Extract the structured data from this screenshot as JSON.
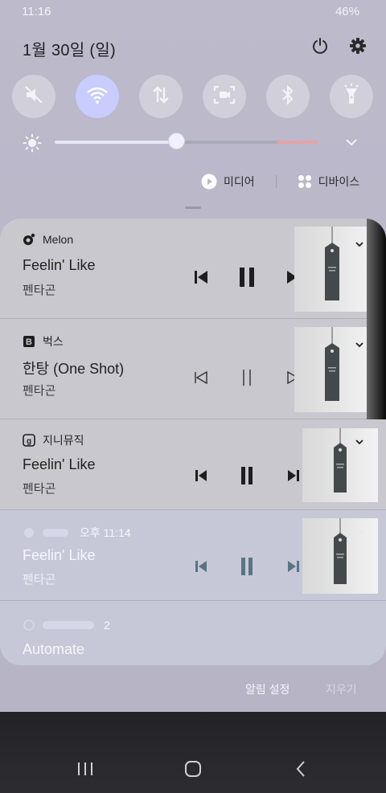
{
  "status_bar": {
    "time": "11:16",
    "battery": "46%"
  },
  "header": {
    "date": "1월 30일 (일)"
  },
  "quick_settings": {
    "tiles": [
      {
        "icon": "sound-off-icon",
        "active": false
      },
      {
        "icon": "wifi-icon",
        "active": true
      },
      {
        "icon": "mobile-data-icon",
        "active": false
      },
      {
        "icon": "screen-recorder-icon",
        "active": false
      },
      {
        "icon": "bluetooth-icon",
        "active": false
      },
      {
        "icon": "flashlight-icon",
        "active": false
      }
    ],
    "brightness_level": 0.46
  },
  "media_row": {
    "media_label": "미디어",
    "devices_label": "디바이스"
  },
  "notifications": [
    {
      "app": "Melon",
      "title": "Feelin' Like",
      "artist": "펜타곤",
      "icon": "melon-app-icon"
    },
    {
      "app": "벅스",
      "title": "한탕 (One Shot)",
      "artist": "펜타곤",
      "icon": "bugs-app-icon"
    },
    {
      "app": "지니뮤직",
      "title": "Feelin' Like",
      "artist": "펜타곤",
      "icon": "genie-app-icon"
    },
    {
      "app": "",
      "time": "오후 11:14",
      "title": "Feelin' Like",
      "artist": "펜타곤",
      "icon": "music-app-icon"
    },
    {
      "app": "",
      "count": "2",
      "title": "Automate",
      "icon": "automate-app-icon"
    }
  ],
  "footer": {
    "settings_label": "알림 설정",
    "clear_label": "지우기"
  },
  "colors": {
    "accent": "#c8ccff",
    "panel": "#c9c8cf",
    "background": "#b9b7c8"
  }
}
